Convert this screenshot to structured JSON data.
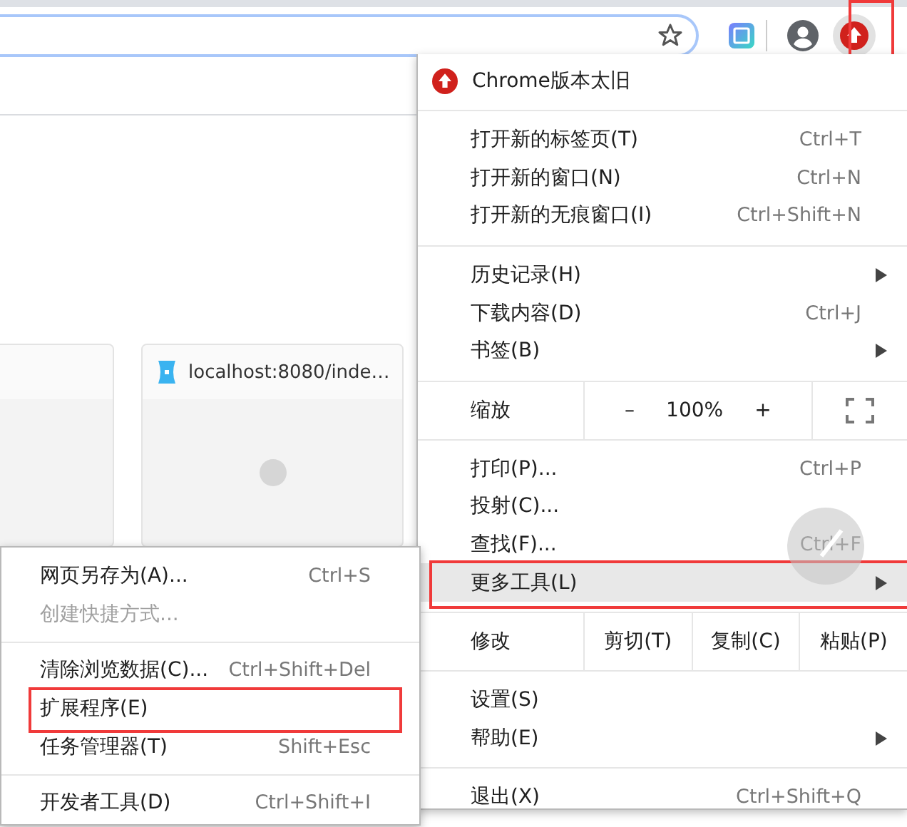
{
  "toolbar": {
    "update_button": {
      "highlighted": true
    }
  },
  "page": {
    "tiles": [
      {
        "kind": "blank"
      },
      {
        "kind": "site",
        "title": "localhost:8080/inde…"
      }
    ]
  },
  "menu": {
    "items": [
      {
        "kind": "notice",
        "label": "Chrome版本太旧"
      },
      {
        "kind": "divider"
      },
      {
        "kind": "item",
        "label": "打开新的标签页(T)",
        "shortcut": "Ctrl+T",
        "submenu": false,
        "selected": false,
        "highlighted": false
      },
      {
        "kind": "item",
        "label": "打开新的窗口(N)",
        "shortcut": "Ctrl+N",
        "submenu": false,
        "selected": false,
        "highlighted": false
      },
      {
        "kind": "item",
        "label": "打开新的无痕窗口(I)",
        "shortcut": "Ctrl+Shift+N",
        "submenu": false,
        "selected": false,
        "highlighted": false
      },
      {
        "kind": "divider"
      },
      {
        "kind": "item",
        "label": "历史记录(H)",
        "submenu": true,
        "selected": false,
        "highlighted": false
      },
      {
        "kind": "item",
        "label": "下载内容(D)",
        "shortcut": "Ctrl+J",
        "submenu": false,
        "selected": false,
        "highlighted": false
      },
      {
        "kind": "item",
        "label": "书签(B)",
        "submenu": true,
        "selected": false,
        "highlighted": false
      },
      {
        "kind": "divider"
      },
      {
        "kind": "zoom",
        "label": "缩放",
        "minus": "–",
        "value": "100%",
        "plus": "+"
      },
      {
        "kind": "divider"
      },
      {
        "kind": "item",
        "label": "打印(P)...",
        "shortcut": "Ctrl+P",
        "submenu": false,
        "selected": false,
        "highlighted": false
      },
      {
        "kind": "item",
        "label": "投射(C)...",
        "submenu": false,
        "selected": false,
        "highlighted": false
      },
      {
        "kind": "item",
        "label": "查找(F)...",
        "shortcut": "Ctrl+F",
        "submenu": false,
        "selected": false,
        "highlighted": false
      },
      {
        "kind": "item",
        "label": "更多工具(L)",
        "submenu": true,
        "selected": true,
        "highlighted": true
      },
      {
        "kind": "divider"
      },
      {
        "kind": "edit",
        "label": "修改",
        "actions": [
          "剪切(T)",
          "复制(C)",
          "粘贴(P)"
        ]
      },
      {
        "kind": "divider"
      },
      {
        "kind": "item",
        "label": "设置(S)",
        "submenu": false,
        "selected": false,
        "highlighted": false
      },
      {
        "kind": "item",
        "label": "帮助(E)",
        "submenu": true,
        "selected": false,
        "highlighted": false
      },
      {
        "kind": "divider"
      },
      {
        "kind": "item",
        "label": "退出(X)",
        "shortcut": "Ctrl+Shift+Q",
        "submenu": false,
        "selected": false,
        "highlighted": false
      }
    ]
  },
  "submenu": {
    "items": [
      {
        "kind": "item",
        "label": "网页另存为(A)...",
        "shortcut": "Ctrl+S",
        "disabled": false,
        "highlighted": false
      },
      {
        "kind": "item",
        "label": "创建快捷方式...",
        "disabled": true,
        "highlighted": false
      },
      {
        "kind": "divider"
      },
      {
        "kind": "item",
        "label": "清除浏览数据(C)...",
        "shortcut": "Ctrl+Shift+Del",
        "disabled": false,
        "highlighted": false
      },
      {
        "kind": "item",
        "label": "扩展程序(E)",
        "disabled": false,
        "highlighted": true
      },
      {
        "kind": "item",
        "label": "任务管理器(T)",
        "shortcut": "Shift+Esc",
        "disabled": false,
        "highlighted": false
      },
      {
        "kind": "divider"
      },
      {
        "kind": "item",
        "label": "开发者工具(D)",
        "shortcut": "Ctrl+Shift+I",
        "disabled": false,
        "highlighted": false
      }
    ]
  }
}
